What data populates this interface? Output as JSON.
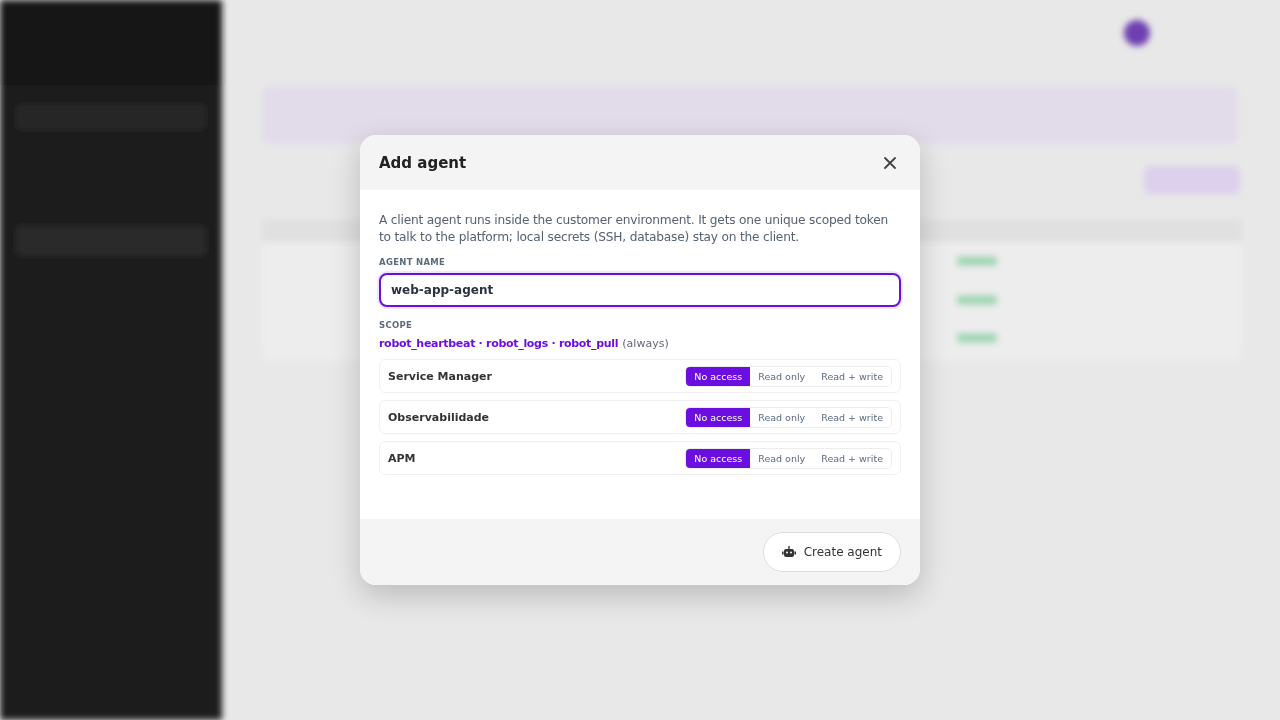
{
  "dialog": {
    "title": "Add agent",
    "description": "A client agent runs inside the customer environment. It gets one unique scoped token to talk to the platform; local secrets (SSH, database) stay on the client.",
    "name_field": {
      "label": "AGENT NAME",
      "value": "web-app-agent"
    },
    "scope": {
      "label": "SCOPE",
      "fixed": "robot_heartbeat · robot_logs · robot_pull",
      "note": "(always)"
    },
    "permissions": [
      {
        "name": "Service Manager",
        "options": [
          {
            "label": "No access",
            "selected": true
          },
          {
            "label": "Read only",
            "selected": false
          },
          {
            "label": "Read + write",
            "selected": false
          }
        ]
      },
      {
        "name": "Observabilidade",
        "options": [
          {
            "label": "No access",
            "selected": true
          },
          {
            "label": "Read only",
            "selected": false
          },
          {
            "label": "Read + write",
            "selected": false
          }
        ]
      },
      {
        "name": "APM",
        "options": [
          {
            "label": "No access",
            "selected": true
          },
          {
            "label": "Read only",
            "selected": false
          },
          {
            "label": "Read + write",
            "selected": false
          }
        ]
      }
    ],
    "submit": "Create agent"
  }
}
